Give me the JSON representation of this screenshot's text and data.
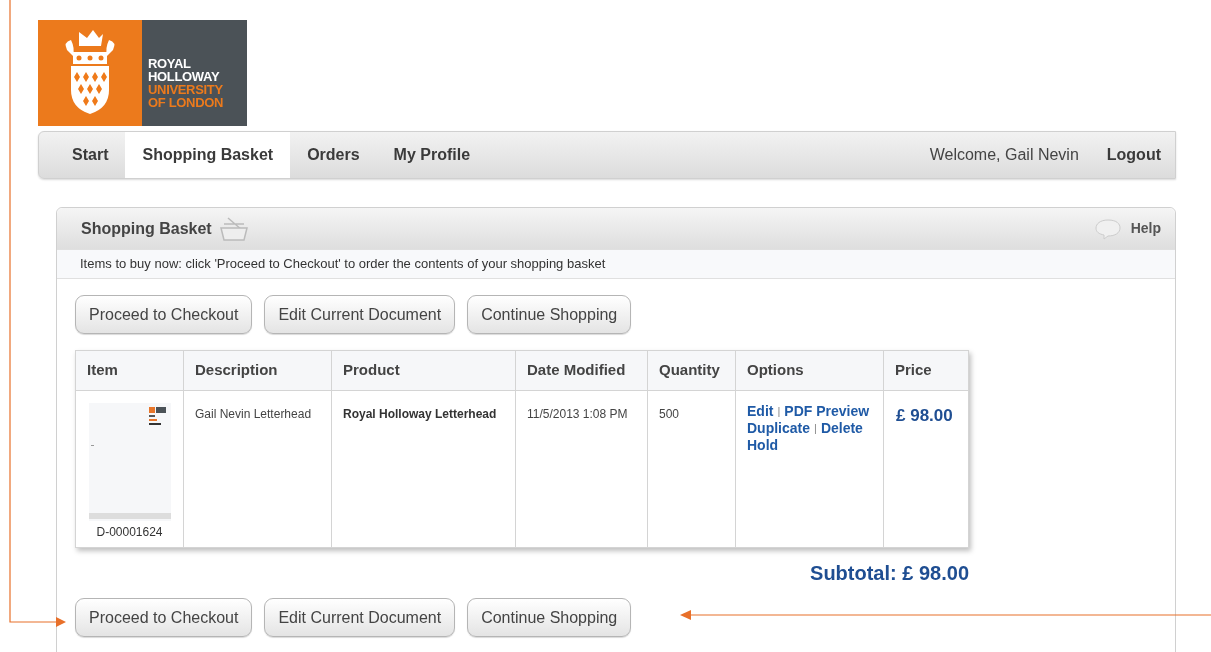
{
  "logo": {
    "lines": [
      {
        "text": "ROYAL",
        "kind": "name"
      },
      {
        "text": "HOLLOWAY",
        "kind": "name"
      },
      {
        "text": "UNIVERSITY",
        "kind": "sub"
      },
      {
        "text": "OF LONDON",
        "kind": "sub"
      }
    ]
  },
  "nav": {
    "tabs": [
      {
        "label": "Start",
        "selected": false
      },
      {
        "label": "Shopping Basket",
        "selected": true
      },
      {
        "label": "Orders",
        "selected": false
      },
      {
        "label": "My Profile",
        "selected": false
      }
    ],
    "welcome": "Welcome, Gail Nevin",
    "logout": "Logout"
  },
  "panel": {
    "title": "Shopping Basket",
    "help": "Help",
    "info": "Items to buy now: click 'Proceed to Checkout' to order the contents of your shopping basket",
    "buttons_top": [
      "Proceed to Checkout",
      "Edit Current Document",
      "Continue Shopping"
    ],
    "table": {
      "columns": [
        "Item",
        "Description",
        "Product",
        "Date Modified",
        "Quantity",
        "Options",
        "Price"
      ],
      "rows": [
        {
          "item_id": "D-00001624",
          "description": "Gail Nevin Letterhead",
          "product": "Royal Holloway Letterhead",
          "date_modified": "11/5/2013 1:08 PM",
          "quantity": "500",
          "options": [
            [
              "Edit",
              "PDF Preview"
            ],
            [
              "Duplicate",
              "Delete"
            ],
            [
              "Hold"
            ]
          ],
          "separator": "|",
          "price": "£ 98.00"
        }
      ]
    },
    "subtotal": "Subtotal: £ 98.00",
    "buttons_bottom": [
      "Proceed to Checkout",
      "Edit Current Document",
      "Continue Shopping"
    ]
  }
}
